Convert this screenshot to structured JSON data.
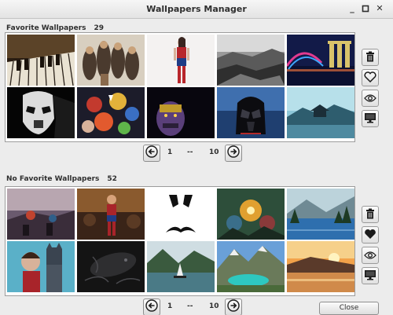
{
  "window": {
    "title": "Wallpapers Manager",
    "controls": [
      "minimize",
      "maximize",
      "close"
    ]
  },
  "favorites": {
    "label": "Favorite Wallpapers",
    "count": "29",
    "thumbnails": [
      {
        "subject": "piano keys close-up"
      },
      {
        "subject": "guardians of the galaxy group"
      },
      {
        "subject": "wonder woman figure"
      },
      {
        "subject": "rocky shoreline black and white"
      },
      {
        "subject": "marina bay sands night skyline"
      },
      {
        "subject": "stormtrooper helmet black and white"
      },
      {
        "subject": "superheroes group cartoon"
      },
      {
        "subject": "thanos face"
      },
      {
        "subject": "darth vader helmet"
      },
      {
        "subject": "misty lake pagoda"
      }
    ],
    "pager": {
      "current": "1",
      "separator": "--",
      "total": "10"
    },
    "side_buttons": {
      "delete_icon": "trash-icon",
      "favorite_icon": "heart-outline-icon",
      "preview_icon": "eye-icon",
      "desktop_icon": "monitor-icon"
    }
  },
  "non_favorites": {
    "label": "No Favorite Wallpapers",
    "count": "52",
    "thumbnails": [
      {
        "subject": "fantasy battle scene"
      },
      {
        "subject": "wonder woman battle"
      },
      {
        "subject": "mustache face minimal"
      },
      {
        "subject": "fantasy creatures battle"
      },
      {
        "subject": "mountain lake forest"
      },
      {
        "subject": "batman and wonder woman comic"
      },
      {
        "subject": "alien creature dark"
      },
      {
        "subject": "fjord with sailboat"
      },
      {
        "subject": "turquoise mountain lake"
      },
      {
        "subject": "sunset river landscape"
      }
    ],
    "pager": {
      "current": "1",
      "separator": "--",
      "total": "10"
    },
    "side_buttons": {
      "delete_icon": "trash-icon",
      "favorite_icon": "heart-filled-icon",
      "preview_icon": "eye-icon",
      "desktop_icon": "monitor-icon"
    }
  },
  "close_button": {
    "label": "Close"
  }
}
